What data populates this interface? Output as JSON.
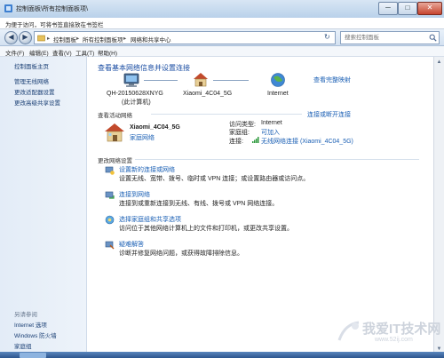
{
  "window": {
    "title": "控制面板\\所有控制面板项\\",
    "controls": {
      "minimize": "─",
      "maximize": "□",
      "close": "✕"
    }
  },
  "infobar": {
    "text": "为便于访问，可将书签直接放在书签栏"
  },
  "nav": {
    "back": "◀",
    "forward": "▶",
    "breadcrumb": [
      "控制面板",
      "所有控制面板项",
      "网络和共享中心"
    ],
    "separator": "▸",
    "refresh": "↻",
    "search_placeholder": "搜索控制面板"
  },
  "menu": {
    "items": [
      "文件(F)",
      "编辑(E)",
      "查看(V)",
      "工具(T)",
      "帮助(H)"
    ]
  },
  "sidebar": {
    "home": "控制面板主页",
    "links": [
      "管理无线网络",
      "更改适配器设置",
      "更改高级共享设置"
    ],
    "see_also_header": "另请参阅",
    "see_also": [
      "Internet 选项",
      "Windows 防火墙",
      "家庭组"
    ]
  },
  "main": {
    "title": "查看基本网络信息并设置连接",
    "full_map": "查看完整映射",
    "map": {
      "computer_name": "QH-20150628XNYG",
      "computer_sub": "(此计算机)",
      "network_name": "Xiaomi_4C04_5G",
      "internet": "Internet"
    },
    "active_header": "查看活动网络",
    "connect_disconnect": "连接或断开连接",
    "active": {
      "name": "Xiaomi_4C04_5G",
      "type": "家庭网络",
      "access_type_label": "访问类型:",
      "access_type_value": "Internet",
      "homegroup_label": "家庭组:",
      "homegroup_value": "可加入",
      "connection_label": "连接:",
      "connection_value": "无线网络连接 (Xiaomi_4C04_5G)"
    },
    "change_header": "更改网络设置",
    "tasks": [
      {
        "icon": "new-connection-icon",
        "title": "设置新的连接或网络",
        "desc": "设置无线、宽带、拨号、临时或 VPN 连接；或设置路由器或访问点。"
      },
      {
        "icon": "connect-network-icon",
        "title": "连接到网络",
        "desc": "连接到或重新连接到无线、有线、拨号或 VPN 网络连接。"
      },
      {
        "icon": "homegroup-icon",
        "title": "选择家庭组和共享选项",
        "desc": "访问位于其他网络计算机上的文件和打印机，或更改共享设置。"
      },
      {
        "icon": "troubleshoot-icon",
        "title": "疑难解答",
        "desc": "诊断并修复网络问题，或获得故障排除信息。"
      }
    ]
  },
  "watermark": {
    "text": "我爱IT技术网",
    "url": "www.52ij.com"
  },
  "colors": {
    "accent": "#1a5fb4",
    "title_blue": "#1b4ea3",
    "sidebar_bg": "#e3ecf7"
  }
}
